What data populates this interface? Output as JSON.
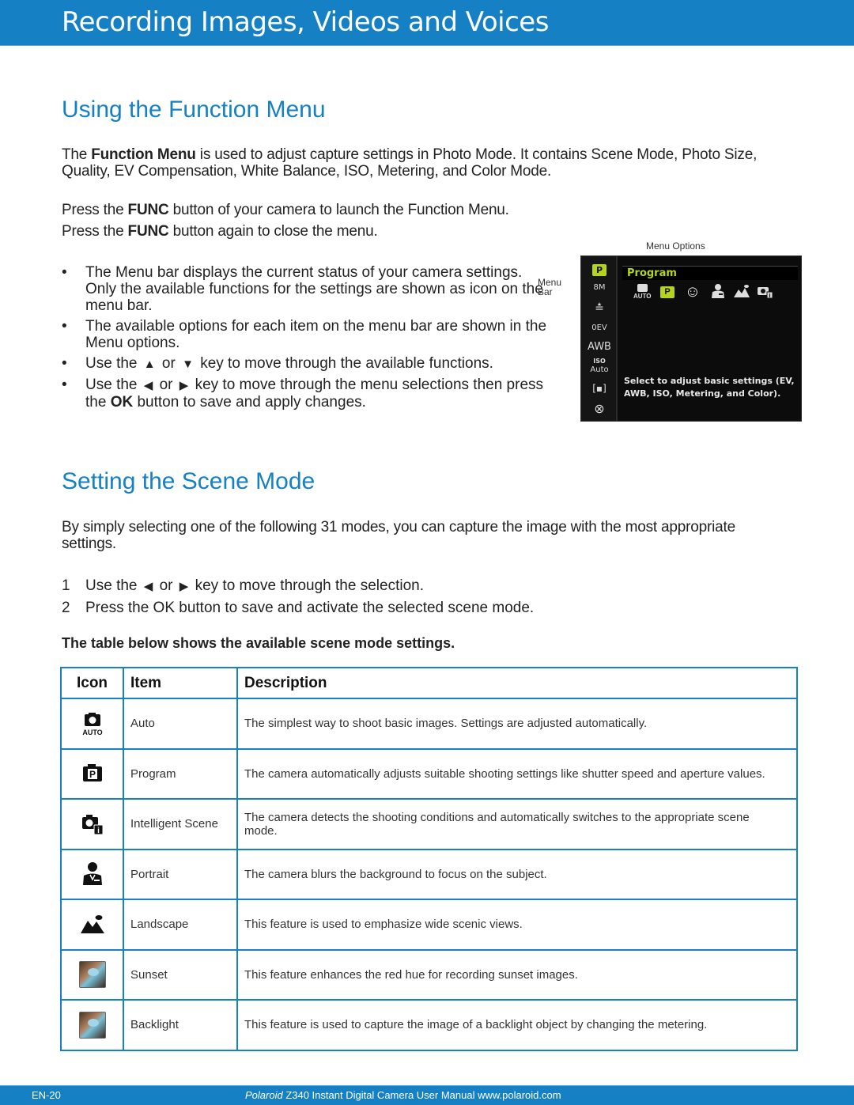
{
  "header": {
    "title": "Recording Images, Videos and Voices"
  },
  "function_menu": {
    "heading": "Using the Function Menu",
    "intro": {
      "pre": "The ",
      "bold": "Function Menu",
      "post": " is used to adjust capture settings in Photo Mode. It contains Scene Mode, Photo Size, Quality, EV Compensation, White Balance, ISO, Metering, and Color Mode."
    },
    "press_lines": [
      {
        "pre": "Press the ",
        "bold": "FUNC",
        "post": " button of your camera to launch the Function Menu."
      },
      {
        "pre": "Press the ",
        "bold": "FUNC",
        "post": " button again to close the menu."
      }
    ],
    "bullets": [
      {
        "text": "The Menu bar displays the current status of your camera settings. Only the available functions for the settings are shown as icon on the menu bar."
      },
      {
        "text": "The available options for each item on the menu bar are shown in the Menu options."
      },
      {
        "pre": "Use the ",
        "key1": "▲",
        "or": " or ",
        "key2": "▼",
        "post": "  key to move through the available functions."
      },
      {
        "pre": "Use the ",
        "key1": "◀",
        "or": " or ",
        "key2": "▶",
        "post": " key to move through the menu selections then press the ",
        "bold": "OK",
        "post2": " button to save and apply changes."
      }
    ],
    "bullet_char": "•",
    "screen": {
      "menu_bar_label_1": "Menu",
      "menu_bar_label_2": "Bar",
      "menu_options_label": "Menu Options",
      "title": "Program",
      "sidebar_items": [
        "P",
        "8M",
        "≛",
        "0EV",
        "AWB",
        "ISO",
        "Auto",
        "[▪]",
        "⊗"
      ],
      "mode_icons": [
        "AUTO",
        "P",
        "☺",
        "portrait",
        "landscape",
        "i"
      ],
      "help_text": "Select to adjust basic settings (EV, AWB, ISO, Metering, and Color).",
      "accent_color": "#b5d51a"
    }
  },
  "scene_mode": {
    "heading": "Setting the Scene Mode",
    "intro": "By simply selecting one of the following 31 modes, you can capture the image with the most appropriate settings.",
    "steps": [
      {
        "num": "1",
        "pre": "Use the ",
        "key1": "◀",
        "or": " or ",
        "key2": "▶",
        "post": " key to move through the selection."
      },
      {
        "num": "2",
        "text": "Press the OK button to save and activate the selected scene mode."
      }
    ],
    "table_caption": "The table below shows the available scene mode settings.",
    "table": {
      "headers": [
        "Icon",
        "Item",
        "Description"
      ],
      "rows": [
        {
          "icon": "auto-camera-icon",
          "item": "Auto",
          "description": "The simplest way to shoot basic images. Settings are adjusted automatically."
        },
        {
          "icon": "program-icon",
          "item": "Program",
          "description": "The camera automatically adjusts suitable shooting settings like shutter speed and aperture values."
        },
        {
          "icon": "intelligent-scene-icon",
          "item": "Intelligent Scene",
          "description": "The camera detects the shooting conditions and automatically switches to the appropriate scene mode."
        },
        {
          "icon": "portrait-icon",
          "item": "Portrait",
          "description": "The camera blurs the background to focus on the subject."
        },
        {
          "icon": "landscape-icon",
          "item": "Landscape",
          "description": "This feature is used to emphasize wide scenic views."
        },
        {
          "icon": "sunset-photo-icon",
          "item": "Sunset",
          "description": "This feature enhances the red hue for recording sunset images."
        },
        {
          "icon": "backlight-photo-icon",
          "item": "Backlight",
          "description": "This feature is used to capture the image of a backlight object by changing the metering."
        }
      ]
    }
  },
  "footer": {
    "page": "EN-20",
    "brand": "Polaroid",
    "text": " Z340 Instant Digital Camera User Manual www.polaroid.com"
  },
  "colors": {
    "brand_blue": "#1580c4",
    "table_border": "#1a80c6"
  }
}
